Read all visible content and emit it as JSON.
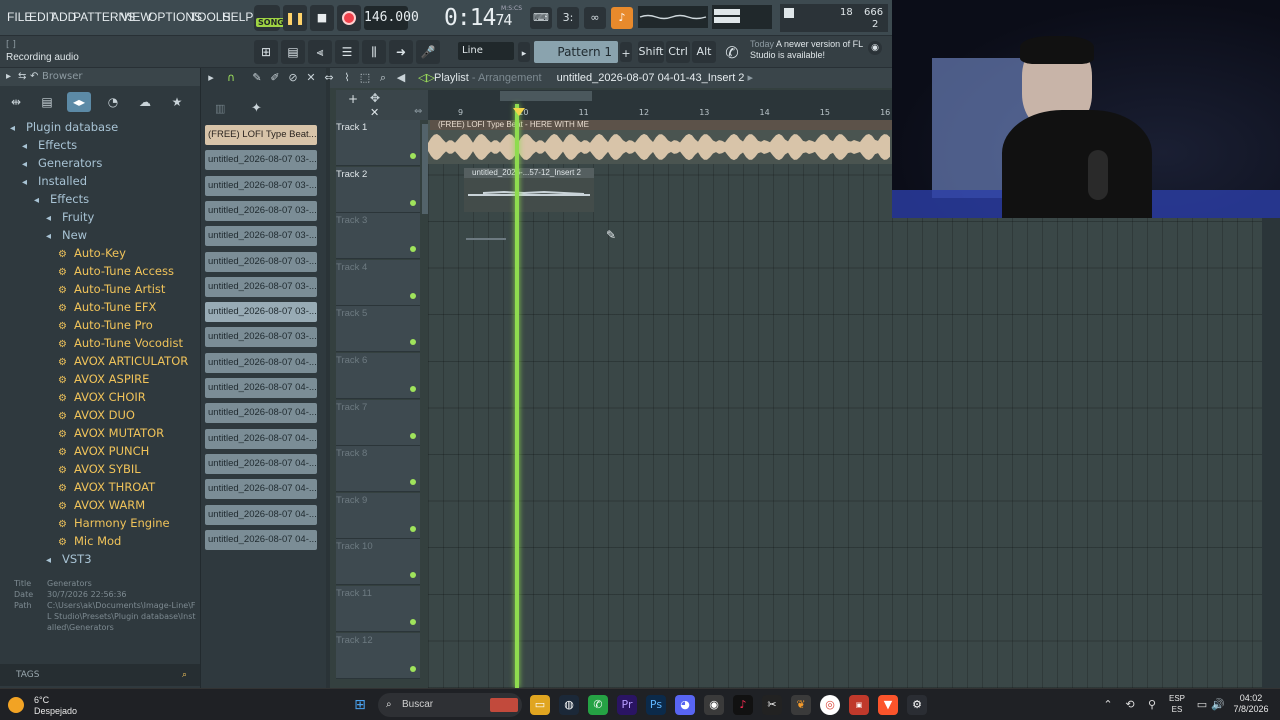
{
  "menu": [
    "FILE",
    "EDIT",
    "ADD",
    "PATTERNS",
    "VIEW",
    "OPTIONS",
    "TOOLS",
    "HELP"
  ],
  "transport": {
    "song_mode": "SONG",
    "tempo": "146.000",
    "time_main": "0:14",
    "time_sub": "74",
    "time_unit": "M:S:CS"
  },
  "cpu": {
    "cpu_value": "18",
    "mem_value": "666",
    "poly_value": "2"
  },
  "hint": {
    "line1": "[ ]",
    "line2": "Recording audio"
  },
  "toolbar2": {
    "snap": "Line",
    "pattern": "Pattern 1",
    "shift": "Shift",
    "ctrl": "Ctrl",
    "alt": "Alt",
    "news_when": "Today",
    "news_text": "A newer version of FL Studio is available!"
  },
  "browser": {
    "header": "Browser",
    "tree": [
      {
        "label": "Plugin database",
        "type": "folder",
        "indent": 0
      },
      {
        "label": "Effects",
        "type": "folder",
        "indent": 1
      },
      {
        "label": "Generators",
        "type": "folder",
        "indent": 1
      },
      {
        "label": "Installed",
        "type": "folder",
        "indent": 1
      },
      {
        "label": "Effects",
        "type": "folder",
        "indent": 2
      },
      {
        "label": "Fruity",
        "type": "folder",
        "indent": 3
      },
      {
        "label": "New",
        "type": "folder",
        "indent": 3
      },
      {
        "label": "Auto-Key",
        "type": "plugin",
        "indent": 4
      },
      {
        "label": "Auto-Tune Access",
        "type": "plugin",
        "indent": 4
      },
      {
        "label": "Auto-Tune Artist",
        "type": "plugin",
        "indent": 4
      },
      {
        "label": "Auto-Tune EFX",
        "type": "plugin",
        "indent": 4
      },
      {
        "label": "Auto-Tune Pro",
        "type": "plugin",
        "indent": 4
      },
      {
        "label": "Auto-Tune Vocodist",
        "type": "plugin",
        "indent": 4
      },
      {
        "label": "AVOX ARTICULATOR",
        "type": "plugin",
        "indent": 4
      },
      {
        "label": "AVOX ASPIRE",
        "type": "plugin",
        "indent": 4
      },
      {
        "label": "AVOX CHOIR",
        "type": "plugin",
        "indent": 4
      },
      {
        "label": "AVOX DUO",
        "type": "plugin",
        "indent": 4
      },
      {
        "label": "AVOX MUTATOR",
        "type": "plugin",
        "indent": 4
      },
      {
        "label": "AVOX PUNCH",
        "type": "plugin",
        "indent": 4
      },
      {
        "label": "AVOX SYBIL",
        "type": "plugin",
        "indent": 4
      },
      {
        "label": "AVOX THROAT",
        "type": "plugin",
        "indent": 4
      },
      {
        "label": "AVOX WARM",
        "type": "plugin",
        "indent": 4
      },
      {
        "label": "Harmony Engine",
        "type": "plugin",
        "indent": 4
      },
      {
        "label": "Mic Mod",
        "type": "plugin",
        "indent": 4
      },
      {
        "label": "VST3",
        "type": "folder",
        "indent": 3
      }
    ],
    "info": {
      "title_k": "Title",
      "title_v": "Generators",
      "date_k": "Date",
      "date_v": "30/7/2026 22:56:36",
      "path_k": "Path",
      "path_v": "C:\\Users\\ak\\Documents\\Image-Line\\FL Studio\\Presets\\Plugin database\\Installed\\Generators"
    },
    "tags": "TAGS"
  },
  "clips": [
    "(FREE) LOFI Type Beat...",
    "untitled_2026-08-07 03-...",
    "untitled_2026-08-07 03-...",
    "untitled_2026-08-07 03-...",
    "untitled_2026-08-07 03-...",
    "untitled_2026-08-07 03-...",
    "untitled_2026-08-07 03-...",
    "untitled_2026-08-07 03-...",
    "untitled_2026-08-07 03-...",
    "untitled_2026-08-07 04-...",
    "untitled_2026-08-07 04-...",
    "untitled_2026-08-07 04-...",
    "untitled_2026-08-07 04-...",
    "untitled_2026-08-07 04-...",
    "untitled_2026-08-07 04-...",
    "untitled_2026-08-07 04-...",
    "untitled_2026-08-07 04-..."
  ],
  "playlist": {
    "title": "Playlist",
    "sep": " - ",
    "mode": "Arrangement",
    "clip_name": "untitled_2026-08-07 04-01-43_Insert 2",
    "ruler": [
      "9",
      "10",
      "11",
      "12",
      "13",
      "14",
      "15",
      "16"
    ],
    "tracks": [
      "Track 1",
      "Track 2",
      "Track 3",
      "Track 4",
      "Track 5",
      "Track 6",
      "Track 7",
      "Track 8",
      "Track 9",
      "Track 10",
      "Track 11",
      "Track 12"
    ],
    "clip1_label": "(FREE) LOFI Type Beat - HERE WITH ME",
    "clip2_label": "untitled_2026-...57-12_Insert 2"
  },
  "taskbar": {
    "temp": "6°C",
    "condition": "Despejado",
    "search": "Buscar",
    "lang1": "ESP",
    "lang2": "ES",
    "time": "04:02",
    "date": "7/8/2026"
  }
}
